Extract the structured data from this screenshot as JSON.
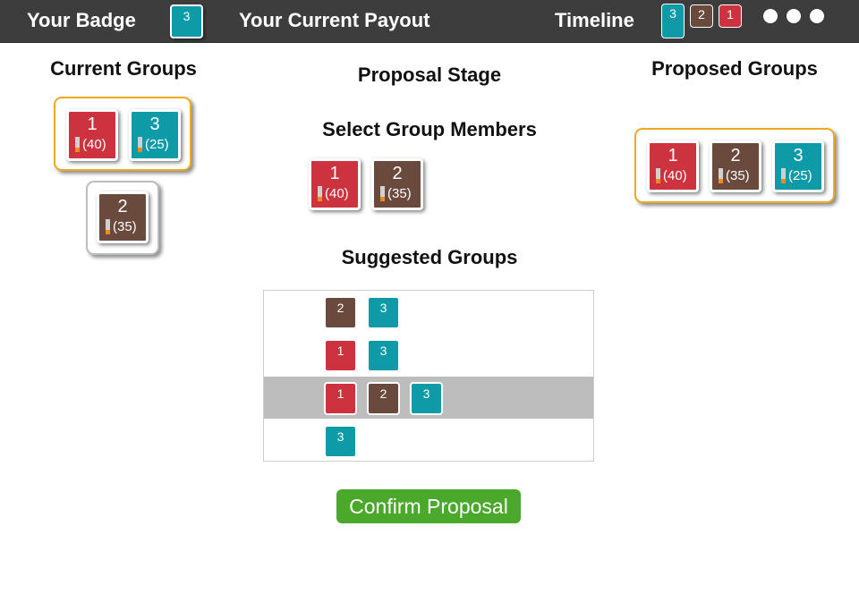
{
  "topbar": {
    "badge_label": "Your Badge",
    "badge_value": "3",
    "payout_label": "Your Current Payout",
    "timeline_label": "Timeline",
    "timeline": [
      "3",
      "2",
      "1"
    ]
  },
  "colors": {
    "red": "#cc333f",
    "brown": "#6a4a3c",
    "teal": "#0e9aa7",
    "gold": "#f0a81e",
    "confirm_green": "#4aa82a",
    "bar_orange": "#ef8a1e"
  },
  "current_groups": {
    "title": "Current Groups",
    "groups": [
      {
        "members": [
          {
            "id": "1",
            "payout": "(40)",
            "level": 0.3
          },
          {
            "id": "3",
            "payout": "(25)",
            "level": 0.3
          }
        ]
      },
      {
        "members": [
          {
            "id": "2",
            "payout": "(35)",
            "level": 0.3
          }
        ]
      }
    ]
  },
  "stage_title": "Proposal Stage",
  "select": {
    "title": "Select Group Members",
    "members": [
      {
        "id": "1",
        "payout": "(40)",
        "level": 0.3
      },
      {
        "id": "2",
        "payout": "(35)",
        "level": 0.3
      }
    ]
  },
  "proposed_groups": {
    "title": "Proposed Groups",
    "members": [
      {
        "id": "1",
        "payout": "(40)",
        "level": 0.3
      },
      {
        "id": "2",
        "payout": "(35)",
        "level": 0.3
      },
      {
        "id": "3",
        "payout": "(25)",
        "level": 0.3
      }
    ]
  },
  "suggested": {
    "title": "Suggested Groups",
    "rows": [
      [
        "2",
        "3"
      ],
      [
        "1",
        "3"
      ],
      [
        "1",
        "2",
        "3"
      ],
      [
        "3"
      ]
    ],
    "selected_row": 3
  },
  "confirm_label": "Confirm Proposal"
}
